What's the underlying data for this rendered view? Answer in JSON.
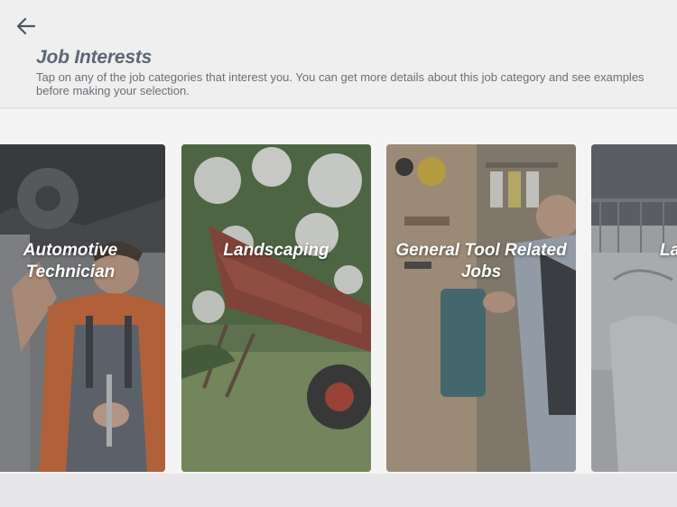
{
  "header": {
    "title": "Job Interests",
    "description": "Tap on any of the job categories that interest you.  You can get more details about this job category and see examples before making your selection."
  },
  "icons": {
    "back": "arrow-left-icon"
  },
  "cards": [
    {
      "label": "Automotive Technician"
    },
    {
      "label": "Landscaping"
    },
    {
      "label": "General Tool Related Jobs"
    },
    {
      "label": "Lau"
    }
  ]
}
